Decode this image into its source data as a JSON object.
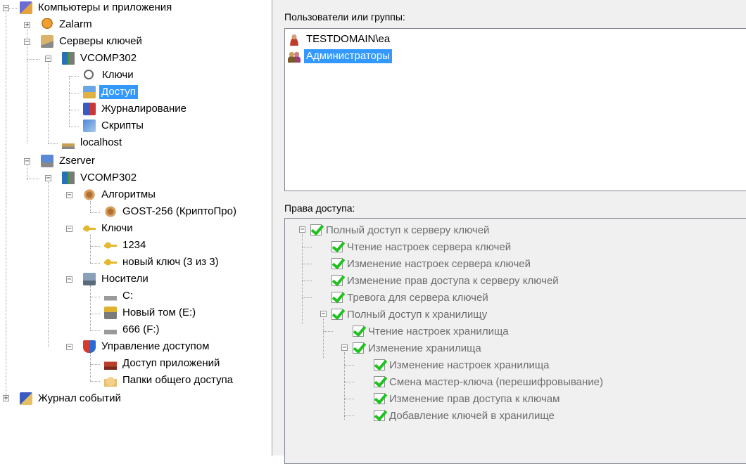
{
  "tree": {
    "computers": "Компьютеры и приложения",
    "zalarm": "Zalarm",
    "key_servers": "Серверы ключей",
    "vcomp1": "VCOMP302",
    "keys1": "Ключи",
    "access": "Доступ",
    "logging": "Журналирование",
    "scripts": "Скрипты",
    "localhost": "localhost",
    "zserver": "Zserver",
    "vcomp2": "VCOMP302",
    "algorithms": "Алгоритмы",
    "gost": "GOST-256 (КриптоПро)",
    "keys2": "Ключи",
    "key_1234": "1234",
    "new_key": "новый ключ (3 из 3)",
    "media": "Носители",
    "drive_c": "C:",
    "drive_e": "Новый том (E:)",
    "drive_f": "666 (F:)",
    "access_mgmt": "Управление доступом",
    "app_access": "Доступ приложений",
    "shared": "Папки общего доступа",
    "events": "Журнал событий"
  },
  "users_panel": {
    "label": "Пользователи или группы:",
    "users": [
      "TESTDOMAIN\\ea",
      "Администраторы"
    ]
  },
  "rights_panel": {
    "label": "Права доступа:",
    "full_server": "Полный доступ к серверу ключей",
    "read_server": "Чтение настроек сервера ключей",
    "change_server": "Изменение настроек сервера ключей",
    "change_rights": "Изменение прав доступа к серверу ключей",
    "alarm": "Тревога для сервера ключей",
    "full_storage": "Полный доступ к хранилищу",
    "read_storage": "Чтение настроек хранилища",
    "change_storage": "Изменение хранилища",
    "change_storage_settings": "Изменение настроек хранилища",
    "master_key": "Смена мастер-ключа (перешифровывание)",
    "key_rights": "Изменение прав доступа к ключам",
    "add_keys": "Добавление ключей в хранилище"
  },
  "colors": {
    "selection": "#3399ff",
    "check": "#1fc21f",
    "disabled_text": "#6d6d6d"
  }
}
